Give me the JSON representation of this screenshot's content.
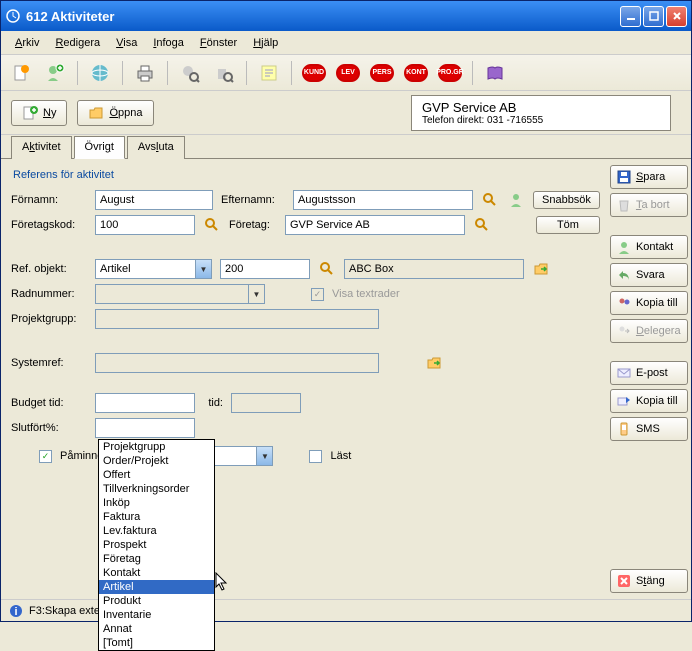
{
  "title": "612 Aktiviteter",
  "menu": [
    "Arkiv",
    "Redigera",
    "Visa",
    "Infoga",
    "Fönster",
    "Hjälp"
  ],
  "toolbar_badges": [
    "KUND",
    "LEV",
    "PERS",
    "KONT",
    "PRO.GR"
  ],
  "secbar": {
    "ny": "Ny",
    "oppna": "Öppna"
  },
  "company": {
    "name": "GVP Service AB",
    "phone": "Telefon direkt:  031 -716555"
  },
  "tabs": [
    "Aktivitet",
    "Övrigt",
    "Avsluta"
  ],
  "section_title": "Referens för aktivitet",
  "labels": {
    "fornamn": "Förnamn:",
    "efternamn": "Efternamn:",
    "foretagskod": "Företagskod:",
    "foretag": "Företag:",
    "refobjekt": "Ref. objekt:",
    "radnummer": "Radnummer:",
    "projektgrupp": "Projektgrupp:",
    "systemref": "Systemref:",
    "budgettid": "Budget tid:",
    "tid": "tid:",
    "slutfort": "Slutfört%:",
    "paminnelse": "Påminnelse",
    "visatextrader": "Visa textrader",
    "last": "Läst"
  },
  "values": {
    "fornamn": "August",
    "efternamn": "Augustsson",
    "foretagskod": "100",
    "foretag": "GVP Service AB",
    "refobjekt_selected": "Artikel",
    "refobjekt_code": "200",
    "refobjekt_name": "ABC Box"
  },
  "buttons": {
    "snabbsok": "Snabbsök",
    "tom": "Töm",
    "spara": "Spara",
    "tabort": "Ta bort",
    "kontakt": "Kontakt",
    "svara": "Svara",
    "kopiatill": "Kopia till",
    "delegera": "Delegera",
    "epost": "E-post",
    "kopiatill2": "Kopia till",
    "sms": "SMS",
    "stang": "Stäng"
  },
  "dropdown_items": [
    "Projektgrupp",
    "Order/Projekt",
    "Offert",
    "Tillverkningsorder",
    "Inköp",
    "Faktura",
    "Lev.faktura",
    "Prospekt",
    "Företag",
    "Kontakt",
    "Artikel",
    "Produkt",
    "Inventarie",
    "Annat",
    "[Tomt]"
  ],
  "dropdown_highlighted": "Artikel",
  "statusbar": "F3:Skapa externt dokument  F7:Text"
}
